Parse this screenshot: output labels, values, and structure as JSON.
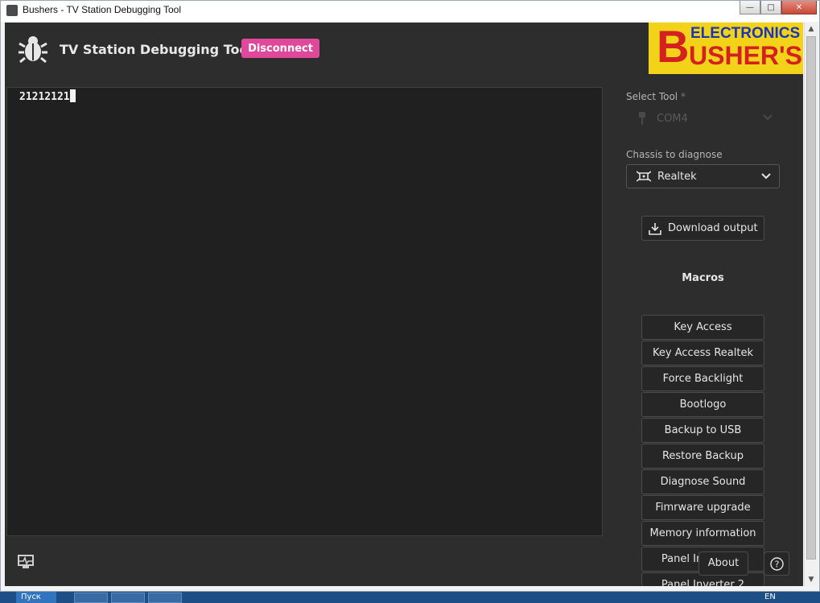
{
  "window": {
    "title": "Bushers - TV Station Debugging Tool",
    "controls": {
      "minimize": "—",
      "maximize": "□",
      "close": "✕"
    }
  },
  "header": {
    "app_title": "TV Station Debugging Tool",
    "disconnect_label": "Disconnect",
    "brand_line1": "ELECTRONICS",
    "brand_initial": "B",
    "brand_rest": "USHER'S"
  },
  "terminal": {
    "output": "21212121"
  },
  "sidebar": {
    "select_tool_label": "Select Tool",
    "select_tool_required": "*",
    "select_tool_value": "COM4",
    "chassis_label": "Chassis to diagnose",
    "chassis_value": "Realtek",
    "download_label": "Download output",
    "macros_title": "Macros",
    "macros": [
      "Key Access",
      "Key Access Realtek",
      "Force Backlight",
      "Bootlogo",
      "Backup to USB",
      "Restore Backup",
      "Diagnose Sound",
      "Fimrware upgrade",
      "Memory information",
      "Panel Inverter 1",
      "Panel Inverter 2"
    ]
  },
  "footer": {
    "about_label": "About",
    "help_label": "?"
  },
  "taskbar": {
    "start_label": "Пуск",
    "language": "EN"
  },
  "colors": {
    "accent_pink": "#e0499b",
    "background": "#2d2d2d",
    "terminal_bg": "#202020",
    "brand_yellow": "#f3d21a",
    "brand_red": "#d4201e",
    "brand_blue": "#1a36b5"
  },
  "icons": {
    "app": "bug-icon",
    "tool": "usb-plug-icon",
    "chassis": "circuit-board-icon",
    "download": "download-icon",
    "monitor": "heartbeat-monitor-icon",
    "help": "question-circle-icon"
  }
}
